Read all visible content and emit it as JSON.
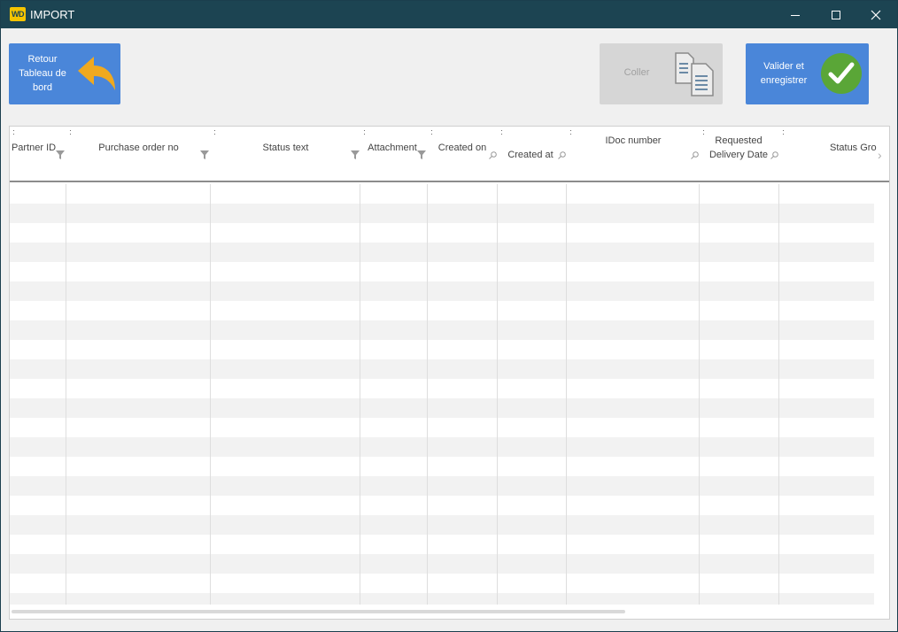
{
  "window": {
    "title": "IMPORT",
    "logo_text": "WD"
  },
  "toolbar": {
    "retour_label": "Retour Tableau de bord",
    "coller_label": "Coller",
    "valider_label": "Valider et enregistrer"
  },
  "table": {
    "columns": [
      {
        "label": "Partner ID",
        "control": "filter"
      },
      {
        "label": "Purchase order no",
        "control": "filter"
      },
      {
        "label": "Status text",
        "control": "filter"
      },
      {
        "label": "Attachment",
        "control": "filter"
      },
      {
        "label": "Created on",
        "control": "search"
      },
      {
        "label": "Created at",
        "control": "search"
      },
      {
        "label": "IDoc number",
        "control": "search"
      },
      {
        "label": "Requested Delivery Date",
        "control": "search"
      },
      {
        "label": "Status Gro",
        "control": "none"
      }
    ],
    "rows": []
  },
  "colors": {
    "titlebar": "#1c4452",
    "button_blue": "#4a86d9",
    "button_disabled": "#d6d6d6",
    "check_green": "#5aa637",
    "arrow_orange": "#f0a91f"
  },
  "icons": {
    "retour": "undo-arrow-icon",
    "coller": "paste-documents-icon",
    "valider": "checkmark-icon"
  }
}
